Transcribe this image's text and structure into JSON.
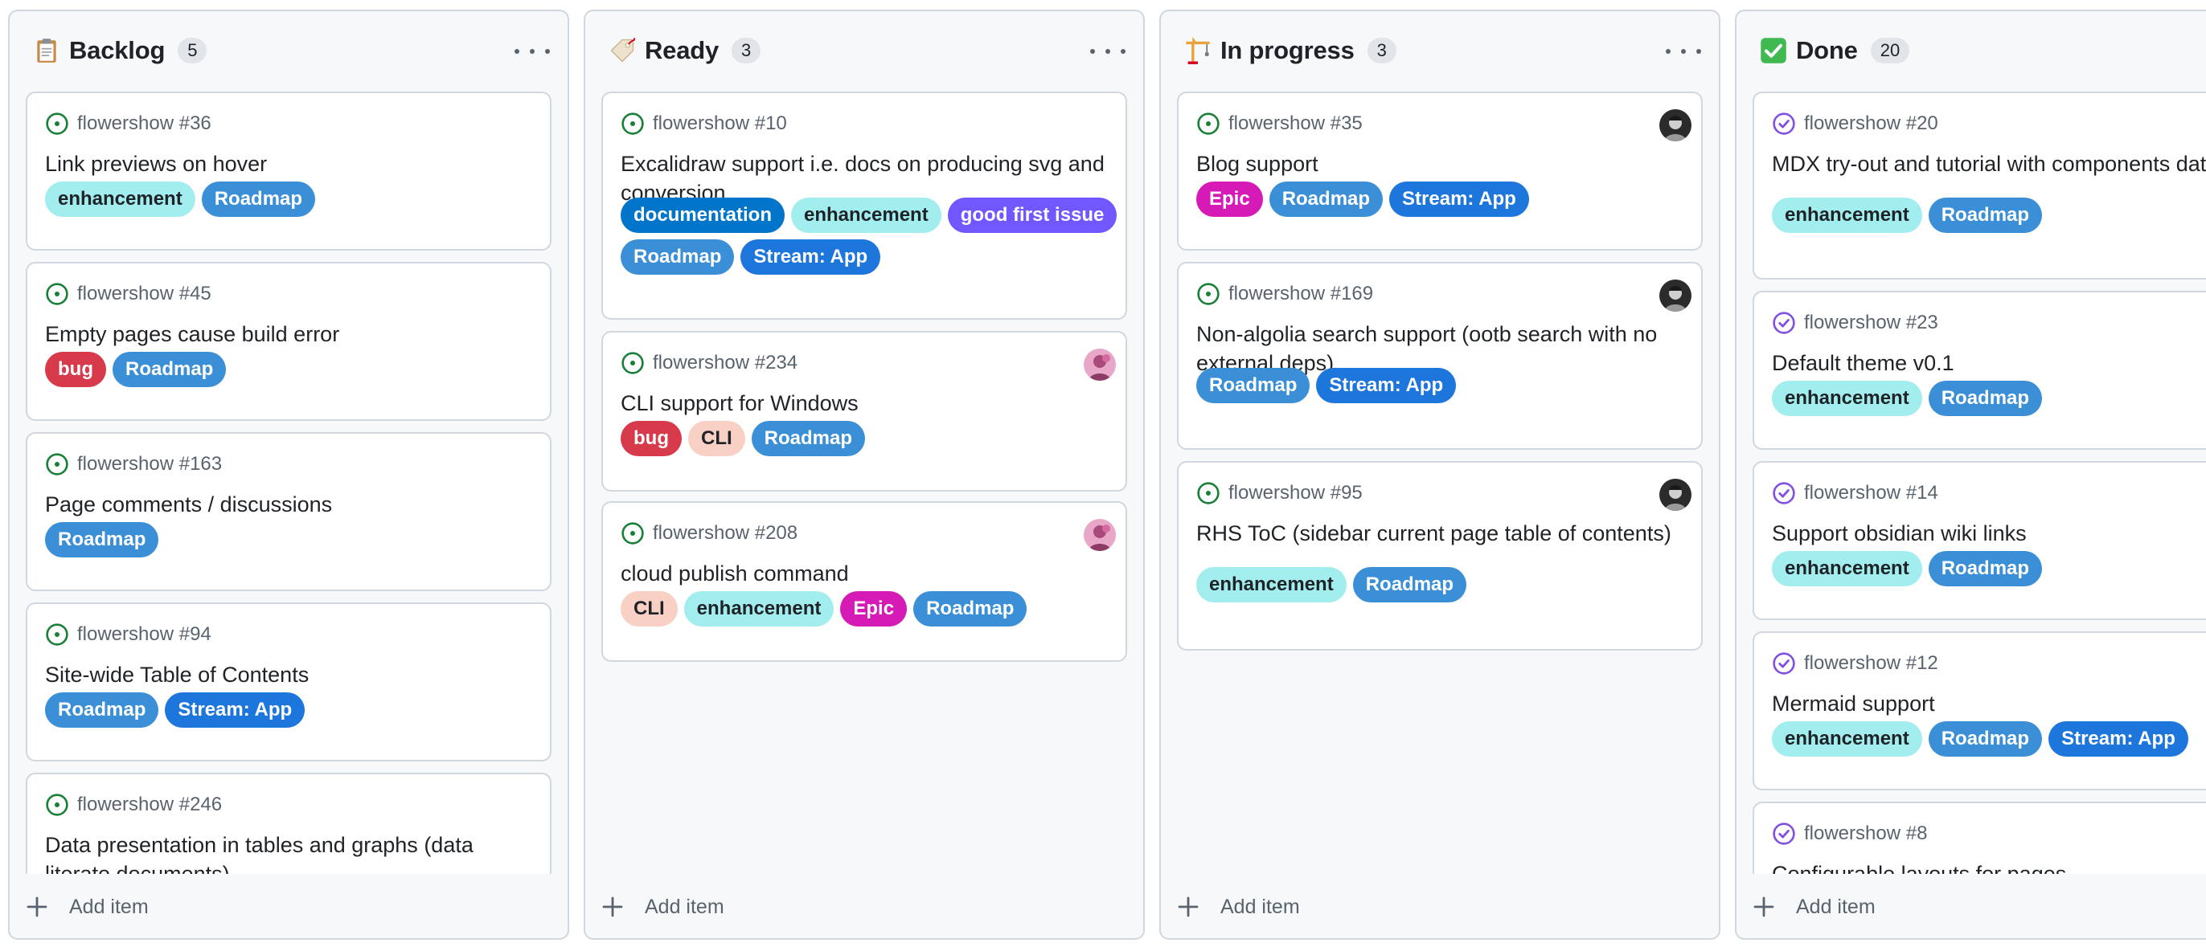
{
  "board": {
    "columns": [
      {
        "title": "Backlog",
        "emoji": "clipboard-icon",
        "count": "5",
        "add_label": "Add item",
        "cards": [
          {
            "ref": "flowershow #36",
            "title": "Link previews on hover",
            "status": "open",
            "labels": [
              {
                "name": "enhancement",
                "color": "#a2eeef"
              },
              {
                "name": "Roadmap",
                "color": "#3b8fd6"
              }
            ]
          },
          {
            "ref": "flowershow #45",
            "title": "Empty pages cause build error",
            "status": "open",
            "labels": [
              {
                "name": "bug",
                "color": "#d73a4a"
              },
              {
                "name": "Roadmap",
                "color": "#3b8fd6"
              }
            ]
          },
          {
            "ref": "flowershow #163",
            "title": "Page comments / discussions",
            "status": "open",
            "labels": [
              {
                "name": "Roadmap",
                "color": "#3b8fd6"
              }
            ]
          },
          {
            "ref": "flowershow #94",
            "title": "Site-wide Table of Contents",
            "status": "open",
            "labels": [
              {
                "name": "Roadmap",
                "color": "#3b8fd6"
              },
              {
                "name": "Stream: App",
                "color": "#1d76db"
              }
            ]
          },
          {
            "ref": "flowershow #246",
            "title": "Data presentation in tables and graphs (data literate documents)",
            "status": "open",
            "labels": []
          }
        ]
      },
      {
        "title": "Ready",
        "emoji": "label-tag-icon",
        "count": "3",
        "add_label": "Add item",
        "cards": [
          {
            "ref": "flowershow #10",
            "title": "Excalidraw support i.e. docs on producing svg and conversion",
            "status": "open",
            "labels": [
              {
                "name": "documentation",
                "color": "#0075ca"
              },
              {
                "name": "enhancement",
                "color": "#a2eeef"
              },
              {
                "name": "good first issue",
                "color": "#7057ff"
              },
              {
                "name": "Roadmap",
                "color": "#3b8fd6"
              },
              {
                "name": "Stream: App",
                "color": "#1d76db"
              }
            ]
          },
          {
            "ref": "flowershow #234",
            "title": "CLI support for Windows",
            "status": "open",
            "avatar": "pink",
            "labels": [
              {
                "name": "bug",
                "color": "#d73a4a"
              },
              {
                "name": "CLI",
                "color": "#f9d0c4"
              },
              {
                "name": "Roadmap",
                "color": "#3b8fd6"
              }
            ]
          },
          {
            "ref": "flowershow #208",
            "title": "cloud publish command",
            "status": "open",
            "avatar": "pink",
            "labels": [
              {
                "name": "CLI",
                "color": "#f9d0c4"
              },
              {
                "name": "enhancement",
                "color": "#a2eeef"
              },
              {
                "name": "Epic",
                "color": "#d61ab5"
              },
              {
                "name": "Roadmap",
                "color": "#3b8fd6"
              }
            ]
          }
        ]
      },
      {
        "title": "In progress",
        "emoji": "construction-crane-icon",
        "count": "3",
        "add_label": "Add item",
        "cards": [
          {
            "ref": "flowershow #35",
            "title": "Blog support",
            "status": "open",
            "avatar": "dark",
            "labels": [
              {
                "name": "Epic",
                "color": "#d61ab5"
              },
              {
                "name": "Roadmap",
                "color": "#3b8fd6"
              },
              {
                "name": "Stream: App",
                "color": "#1d76db"
              }
            ]
          },
          {
            "ref": "flowershow #169",
            "title": "Non-algolia search support (ootb search with no external deps)",
            "status": "open",
            "avatar": "dark",
            "labels": [
              {
                "name": "Roadmap",
                "color": "#3b8fd6"
              },
              {
                "name": "Stream: App",
                "color": "#1d76db"
              }
            ]
          },
          {
            "ref": "flowershow #95",
            "title": "RHS ToC (sidebar current page table of contents)",
            "status": "open",
            "avatar": "dark",
            "labels": [
              {
                "name": "enhancement",
                "color": "#a2eeef"
              },
              {
                "name": "Roadmap",
                "color": "#3b8fd6"
              }
            ]
          }
        ]
      },
      {
        "title": "Done",
        "emoji": "check-mark-icon",
        "count": "20",
        "add_label": "Add item",
        "cards": [
          {
            "ref": "flowershow #20",
            "title": "MDX try-out and tutorial with components data",
            "status": "closed",
            "labels": [
              {
                "name": "enhancement",
                "color": "#a2eeef"
              },
              {
                "name": "Roadmap",
                "color": "#3b8fd6"
              }
            ]
          },
          {
            "ref": "flowershow #23",
            "title": "Default theme v0.1",
            "status": "closed",
            "labels": [
              {
                "name": "enhancement",
                "color": "#a2eeef"
              },
              {
                "name": "Roadmap",
                "color": "#3b8fd6"
              }
            ]
          },
          {
            "ref": "flowershow #14",
            "title": "Support obsidian wiki links",
            "status": "closed",
            "labels": [
              {
                "name": "enhancement",
                "color": "#a2eeef"
              },
              {
                "name": "Roadmap",
                "color": "#3b8fd6"
              }
            ]
          },
          {
            "ref": "flowershow #12",
            "title": "Mermaid support",
            "status": "closed",
            "labels": [
              {
                "name": "enhancement",
                "color": "#a2eeef"
              },
              {
                "name": "Roadmap",
                "color": "#3b8fd6"
              },
              {
                "name": "Stream: App",
                "color": "#1d76db"
              }
            ]
          },
          {
            "ref": "flowershow #8",
            "title": "Configurable layouts for pages",
            "status": "closed",
            "labels": []
          }
        ]
      }
    ]
  },
  "colors": {
    "open": "#1a7f37",
    "closed": "#8250df",
    "label_text_light": "#ffffff",
    "label_text_dark": "#1f2328"
  }
}
